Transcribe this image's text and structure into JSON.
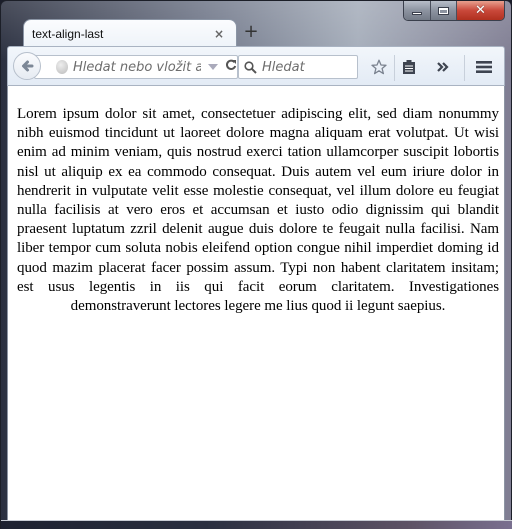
{
  "window": {
    "controls": {
      "minimize": "minimize",
      "maximize": "maximize",
      "close": "close"
    }
  },
  "tabs": [
    {
      "title": "text-align-last",
      "active": true
    }
  ],
  "tab_close_glyph": "×",
  "new_tab_glyph": "+",
  "navbar": {
    "url_placeholder": "Hledat nebo vložit adresu",
    "search_placeholder": "Hledat",
    "reload_glyph": "C",
    "icons": [
      "back-arrow-icon",
      "globe-icon",
      "dropdown-icon",
      "reload-icon",
      "search-icon",
      "bookmark-star-icon",
      "reading-list-icon",
      "overflow-chevron-icon",
      "hamburger-menu-icon"
    ]
  },
  "page": {
    "paragraph": "Lorem ipsum dolor sit amet, consectetuer adipiscing elit, sed diam nonummy nibh euismod tincidunt ut laoreet dolore magna aliquam erat volutpat. Ut wisi enim ad minim veniam, quis nostrud exerci tation ullamcorper suscipit lobortis nisl ut aliquip ex ea commodo consequat. Duis autem vel eum iriure dolor in hendrerit in vulputate velit esse molestie consequat, vel illum dolore eu feugiat nulla facilisis at vero eros et accumsan et iusto odio dignissim qui blandit praesent luptatum zzril delenit augue duis dolore te feugait nulla facilisi. Nam liber tempor cum soluta nobis eleifend option congue nihil imperdiet doming id quod mazim placerat facer possim assum. Typi non habent claritatem insitam; est usus legentis in iis qui facit eorum claritatem. Investigationes demonstraverunt lectores legere me lius quod ii legunt saepius."
  }
}
